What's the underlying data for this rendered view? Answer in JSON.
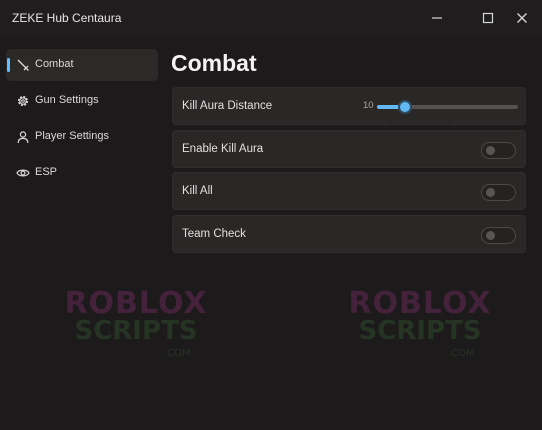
{
  "window": {
    "title": "ZEKE Hub Centaura"
  },
  "sidebar": {
    "items": [
      {
        "label": "Combat",
        "icon": "sword-icon",
        "active": true
      },
      {
        "label": "Gun Settings",
        "icon": "gear-icon",
        "active": false
      },
      {
        "label": "Player Settings",
        "icon": "person-icon",
        "active": false
      },
      {
        "label": "ESP",
        "icon": "eye-icon",
        "active": false
      }
    ]
  },
  "main": {
    "title": "Combat",
    "rows": [
      {
        "label": "Kill Aura Distance",
        "type": "slider",
        "value": "10",
        "fill_fraction": 0.2
      },
      {
        "label": "Enable Kill Aura",
        "type": "toggle",
        "on": false
      },
      {
        "label": "Kill All",
        "type": "toggle",
        "on": false
      },
      {
        "label": "Team Check",
        "type": "toggle",
        "on": false
      }
    ]
  },
  "watermark": {
    "line1": "ROBLOX",
    "line2": "SCRIPTS",
    "line3": ".COM"
  },
  "colors": {
    "accent": "#61b8f3",
    "background": "#1c1a1a",
    "panel": "#2a2727"
  }
}
